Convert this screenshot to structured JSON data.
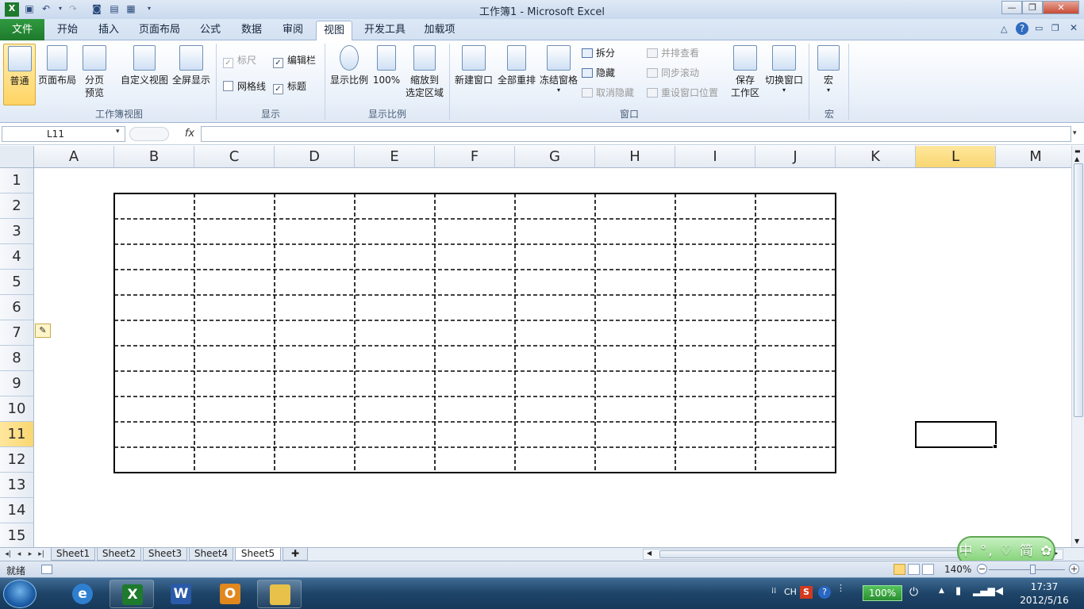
{
  "window": {
    "title": "工作簿1 - Microsoft Excel"
  },
  "tabs": [
    "文件",
    "开始",
    "插入",
    "页面布局",
    "公式",
    "数据",
    "审阅",
    "视图",
    "开发工具",
    "加载项"
  ],
  "ribbon": {
    "workbook_views": {
      "label": "工作簿视图",
      "normal": "普通",
      "page_layout": "页面布局",
      "page_break_1": "分页",
      "page_break_2": "预览",
      "custom_views": "自定义视图",
      "full_screen": "全屏显示"
    },
    "show": {
      "label": "显示",
      "ruler": "标尺",
      "formula_bar": "编辑栏",
      "gridlines": "网格线",
      "headings": "标题"
    },
    "zoom": {
      "label": "显示比例",
      "zoom": "显示比例",
      "hundred": "100%",
      "to_selection_1": "缩放到",
      "to_selection_2": "选定区域"
    },
    "window": {
      "label": "窗口",
      "new_window": "新建窗口",
      "arrange_all": "全部重排",
      "freeze_panes": "冻结窗格",
      "split": "拆分",
      "hide": "隐藏",
      "unhide": "取消隐藏",
      "side_by_side": "并排查看",
      "sync_scroll": "同步滚动",
      "reset_position": "重设窗口位置",
      "save_workspace_1": "保存",
      "save_workspace_2": "工作区",
      "switch_windows": "切换窗口"
    },
    "macros": {
      "label": "宏",
      "macros": "宏"
    }
  },
  "formula_bar": {
    "name_box": "L11",
    "fx": "fx",
    "value": ""
  },
  "grid": {
    "columns": [
      "A",
      "B",
      "C",
      "D",
      "E",
      "F",
      "G",
      "H",
      "I",
      "J",
      "K",
      "L",
      "M"
    ],
    "rows": [
      "1",
      "2",
      "3",
      "4",
      "5",
      "6",
      "7",
      "8",
      "9",
      "10",
      "11",
      "12",
      "13",
      "14",
      "15"
    ],
    "selected_cell": "L11",
    "table_range": "B2:J12"
  },
  "sheets": {
    "tabs": [
      "Sheet1",
      "Sheet2",
      "Sheet3",
      "Sheet4",
      "Sheet5"
    ],
    "active": "Sheet5"
  },
  "ime": {
    "text": "中 °, ♡ 简 ✿"
  },
  "status": {
    "ready": "就绪",
    "zoom": "140%"
  },
  "tray": {
    "lang": "CH",
    "battery": "100%"
  },
  "clock": {
    "time": "17:37",
    "date": "2012/5/16"
  },
  "colors": {
    "file_tab": "#1e7a2d",
    "selected_header": "#f9d671",
    "accent": "#2a4a7a"
  },
  "icons": [
    "save-icon",
    "undo-icon",
    "redo-icon",
    "camera-icon",
    "windows-start-icon",
    "ie-icon",
    "excel-icon",
    "word-icon",
    "outlook-icon",
    "folder-icon",
    "help-icon"
  ]
}
